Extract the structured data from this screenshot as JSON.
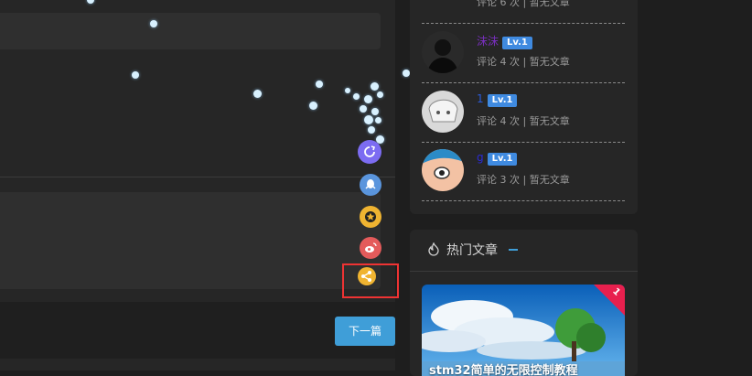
{
  "post_nav": {
    "next_label": "下一篇"
  },
  "comment_ranking": {
    "users": [
      {
        "name": "",
        "level": "",
        "stats": "评论 6 次 |  暂无文章"
      },
      {
        "name": "沫沫",
        "name_color": "#7a2fc0",
        "level": "Lv.1",
        "stats": "评论 4 次 |  暂无文章"
      },
      {
        "name": "1",
        "name_color": "#2b5bd7",
        "level": "Lv.1",
        "stats": "评论 4 次 |  暂无文章"
      },
      {
        "name": "g",
        "name_color": "#2b2bd7",
        "level": "Lv.1",
        "stats": "评论 3 次 |  暂无文章"
      }
    ]
  },
  "hot_articles": {
    "title": "热门文章",
    "items": [
      {
        "rank": "1",
        "caption": "stm32简单的无限控制教程"
      }
    ]
  },
  "share_icons": [
    "refresh-share-icon",
    "qq-icon",
    "star-icon",
    "weibo-icon",
    "share-icon"
  ],
  "colors": {
    "accent": "#3f9ed8",
    "highlight_box": "#e33333",
    "level_badge": "#3f8ae0",
    "rank_ribbon": "#e8204e"
  }
}
